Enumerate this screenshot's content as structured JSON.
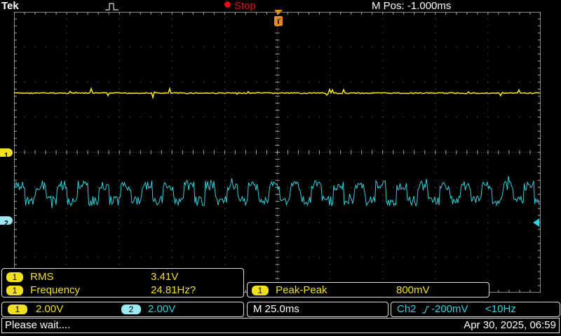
{
  "header": {
    "brand": "Tek",
    "run_state": "Stop",
    "mpos": "M Pos: -1.000ms",
    "trigger_marker": "T"
  },
  "markers": {
    "ch1": "1",
    "ch2": "2"
  },
  "measurements": {
    "rows": [
      {
        "channel": "1",
        "name": "RMS",
        "value": "3.41V"
      },
      {
        "channel": "1",
        "name": "Frequency",
        "value": "24.81Hz?"
      }
    ],
    "peak": {
      "channel": "1",
      "name": "Peak-Peak",
      "value": "800mV"
    }
  },
  "channels": {
    "ch1": {
      "label": "1",
      "scale": "2.00V"
    },
    "ch2": {
      "label": "2",
      "scale": "2.00V"
    }
  },
  "timebase": "M 25.0ms",
  "trigger": {
    "source": "Ch2",
    "level": "-200mV",
    "freq": "<10Hz"
  },
  "status": {
    "message": "Please wait....",
    "datetime": "Apr 30, 2025, 06:59"
  },
  "colors": {
    "ch1": "#f0e020",
    "ch2": "#2ed2e0",
    "trigger": "#f08a10"
  }
}
